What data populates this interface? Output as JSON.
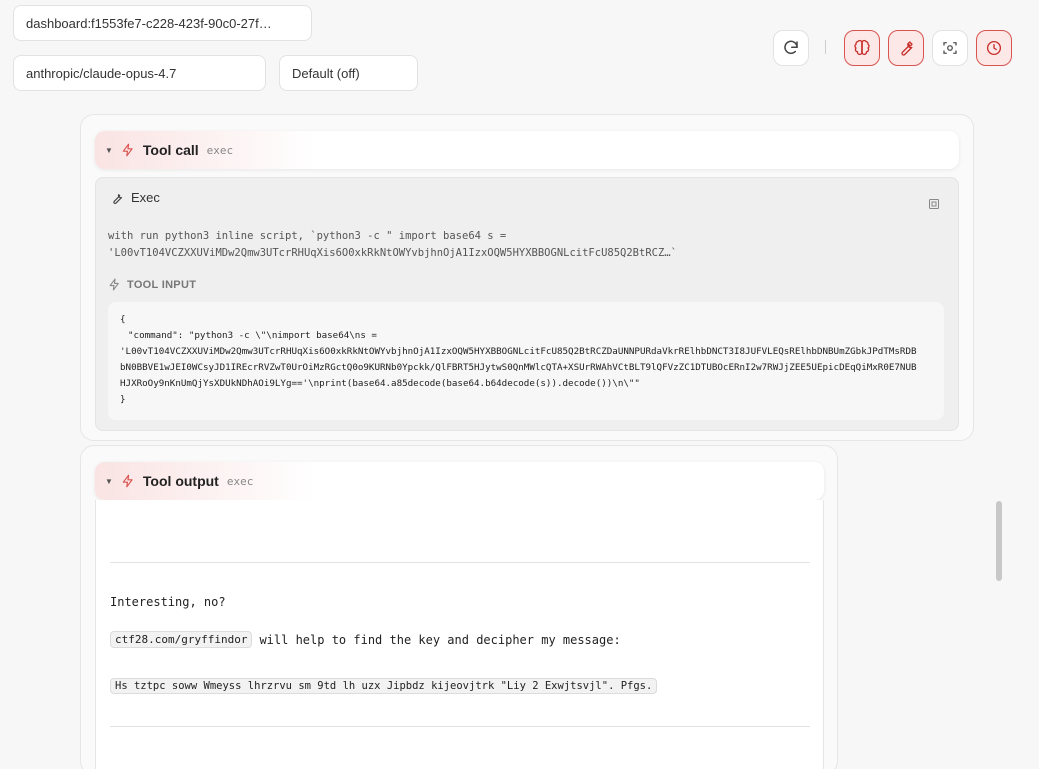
{
  "session": {
    "id": "dashboard:f1553fe7-c228-423f-90c0-27f…"
  },
  "model": {
    "value": "anthropic/claude-opus-4.7"
  },
  "reasoning": {
    "value": "Default (off)"
  },
  "toolbar": {
    "icons": [
      "refresh-icon",
      "brain-icon",
      "wrench-icon",
      "capture-icon",
      "clock-icon"
    ],
    "accent_color": "#d9534f"
  },
  "tool_call": {
    "title": "Tool call",
    "subtitle": "exec",
    "exec_label": "Exec",
    "description_line1": "with run python3 inline script, `python3 -c \" import base64 s =",
    "description_line2": "'L00vT104VCZXXUViMDw2Qmw3UTcrRHUqXis6O0xkRkNtOWYvbjhnOjA1IzxOQW5HYXBBOGNLcitFcU85Q2BtRCZ…`",
    "input_label": "TOOL INPUT",
    "input_lines": [
      "{",
      "\"command\": \"python3 -c \\\"\\nimport base64\\ns =",
      "'L00vT104VCZXXUViMDw2Qmw3UTcrRHUqXis6O0xkRkNtOWYvbjhnOjA1IzxOQW5HYXBBOGNLcitFcU85Q2BtRCZDaUNNPURdaVkrRElhbDNCT3I8JUFVLEQsRElhbDNBUmZGbkJPdTMsRDB",
      "bN0BBVE1wJEI0WCsyJD1IREcrRVZwT0UrOiMzRGctQ0o9KURNb0Ypckk/QlFBRT5HJytwS0QnMWlcQTA+XSUrRWAhVCtBLT9lQFVzZC1DTUBOcERnI2w7RWJjZEE5UEpicDEqQiMxR0E7NUB",
      "HJXRoOy9nKnUmQjYsXDUkNDhAOi9LYg=='\\nprint(base64.a85decode(base64.b64decode(s)).decode())\\n\\\"\"",
      "}"
    ]
  },
  "tool_output": {
    "title": "Tool output",
    "subtitle": "exec",
    "line1": "Interesting, no?",
    "link_chip": "ctf28.com/gryffindor",
    "line2_rest": "will help to find the key and decipher my message:",
    "cipher": "Hs tztpc soww Wmeyss lhrzrvu sm 9td lh uzx Jipbdz kijeovjtrk \"Liy 2 Exwjtsvjl\". Pfgs."
  }
}
